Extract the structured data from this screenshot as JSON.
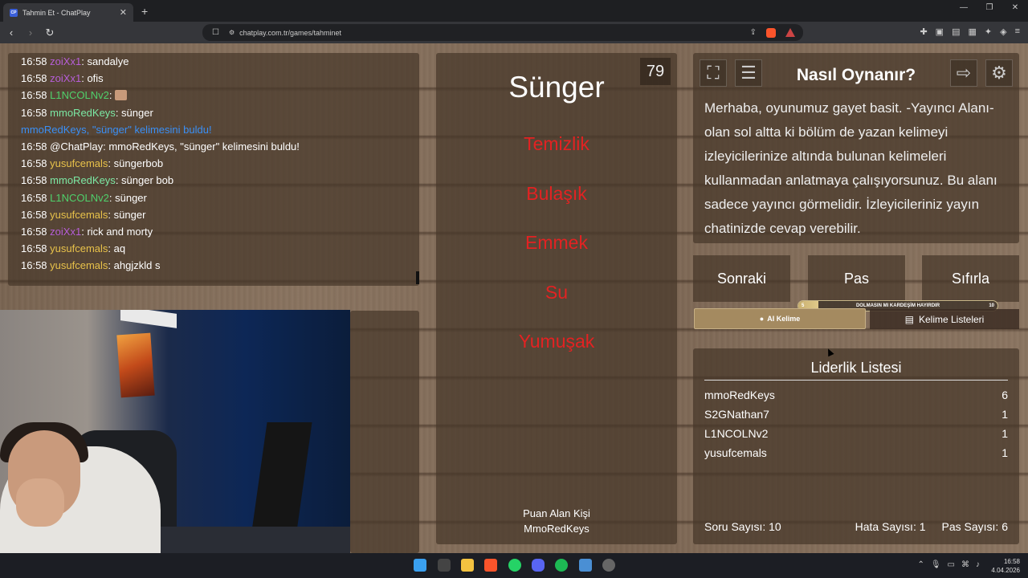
{
  "browser": {
    "tab_title": "Tahmin Et - ChatPlay",
    "tab_favicon": "CP",
    "url": "chatplay.com.tr/games/tahminet"
  },
  "chat": {
    "messages": [
      {
        "time": "16:58",
        "user": "zoiXx1",
        "color": "#b65ed8",
        "text": "sandalye"
      },
      {
        "time": "16:58",
        "user": "zoiXx1",
        "color": "#b65ed8",
        "text": "ofis"
      },
      {
        "time": "16:58",
        "user": "L1NCOLNv2",
        "color": "#4fd06b",
        "text": ""
      },
      {
        "time": "16:58",
        "user": "mmoRedKeys",
        "color": "#7be8a4",
        "text": "sünger"
      },
      {
        "time": "",
        "user": "",
        "color": "#3a8ff5",
        "text": "mmoRedKeys, \"sünger\" kelimesini buldu!"
      },
      {
        "time": "16:58",
        "user": "",
        "color": "#ffffff",
        "text": "@ChatPlay: mmoRedKeys, \"sünger\" kelimesini buldu!"
      },
      {
        "time": "16:58",
        "user": "yusufcemals",
        "color": "#e8c24a",
        "text": "süngerbob"
      },
      {
        "time": "16:58",
        "user": "mmoRedKeys",
        "color": "#7be8a4",
        "text": "sünger bob"
      },
      {
        "time": "16:58",
        "user": "L1NCOLNv2",
        "color": "#4fd06b",
        "text": "sünger"
      },
      {
        "time": "16:58",
        "user": "yusufcemals",
        "color": "#e8c24a",
        "text": "sünger"
      },
      {
        "time": "16:58",
        "user": "zoiXx1",
        "color": "#b65ed8",
        "text": "rick and morty"
      },
      {
        "time": "16:58",
        "user": "yusufcemals",
        "color": "#e8c24a",
        "text": "aq"
      },
      {
        "time": "16:58",
        "user": "yusufcemals",
        "color": "#e8c24a",
        "text": "ahgjzkld s"
      }
    ]
  },
  "game": {
    "counter": "79",
    "word": "Sünger",
    "forbidden": [
      "Temizlik",
      "Bulaşık",
      "Emmek",
      "Su",
      "Yumuşak"
    ],
    "scorer_label": "Puan Alan Kişi",
    "scorer_name": "MmoRedKeys"
  },
  "how": {
    "title": "Nasıl Oynanır?",
    "text": "Merhaba, oyunumuz gayet basit. -Yayıncı Alanı- olan sol altta ki bölüm de yazan kelimeyi izleyicilerinize altında bulunan kelimeleri kullanmadan anlatmaya çalışıyorsunuz. Bu alanı sadece yayıncı görmelidir. İzleyicileriniz yayın chatinizde cevap verebilir."
  },
  "controls": {
    "next": "Sonraki",
    "pass": "Pas",
    "reset": "Sıfırla",
    "progress_label": "DOLMASIN MI KARDEŞİM HAYIRDIR",
    "progress_start": "5",
    "progress_end": "10",
    "progress_value": 0.1,
    "ai_word": "AI Kelime",
    "word_lists": "Kelime Listeleri"
  },
  "leaderboard": {
    "title": "Liderlik Listesi",
    "rows": [
      {
        "name": "mmoRedKeys",
        "score": "6"
      },
      {
        "name": "S2GNathan7",
        "score": "1"
      },
      {
        "name": "L1NCOLNv2",
        "score": "1"
      },
      {
        "name": "yusufcemals",
        "score": "1"
      }
    ],
    "questions": "Soru Sayısı: 10",
    "errors": "Hata Sayısı: 1",
    "passes": "Pas Sayısı: 6"
  },
  "system": {
    "time": "16:58",
    "date": "4.04.2026"
  }
}
